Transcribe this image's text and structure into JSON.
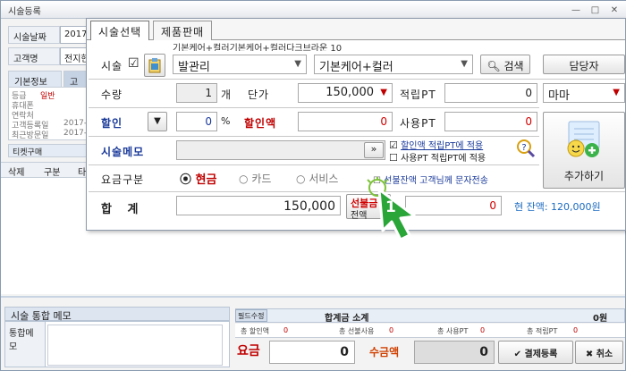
{
  "window": {
    "title": "시술등록",
    "min": "—",
    "max": "□",
    "close": "✕"
  },
  "left_panel": {
    "date_label": "시술날짜",
    "date_value": "2017-",
    "customer_label": "고객명",
    "customer_value": "전지현",
    "tabs": [
      "기본정보",
      "고"
    ],
    "info_rows": [
      {
        "label": "등급",
        "value": "일반"
      },
      {
        "label": "휴대폰",
        "value": ""
      },
      {
        "label": "연락처",
        "value": ""
      },
      {
        "label": "고객등록일",
        "value": "2017-0"
      },
      {
        "label": "최근방문일",
        "value": "2017-0"
      }
    ],
    "ticket_label": "티켓구매",
    "list_headers": [
      "삭제",
      "구분",
      "타"
    ]
  },
  "dialog": {
    "tabs": [
      "시술선택",
      "제품판매"
    ],
    "crumbs": [
      "기본케어+컬러",
      "기본케어+컬러",
      "다크브라운 10"
    ],
    "service_label": "시술",
    "service_check": "☑",
    "category_value": "발관리",
    "item_value": "기본케어+컬러",
    "search_label": "검색",
    "staff_button": "담당자",
    "staff_value": "마마",
    "qty_label": "수량",
    "qty_value": "1",
    "qty_unit": "개",
    "price_label": "단가",
    "price_value": "150,000",
    "earn_pt_label": "적립PT",
    "earn_pt_value": "0",
    "discount_label": "할인",
    "discount_value": "0",
    "discount_unit": "%",
    "discount_amt_label": "할인액",
    "discount_amt_value": "0",
    "use_pt_label": "사용PT",
    "use_pt_value": "0",
    "memo_label": "시술메모",
    "memo_btn": "»",
    "chk1_label": "할인액 적립PT에 적용",
    "chk2_label": "사용PT 적립PT에 적용",
    "add_button": "추가하기",
    "pay_label": "요금구분",
    "pay_options": [
      "현금",
      "카드",
      "서비스"
    ],
    "prepaid_sms_label": "선불잔액 고객님께 문자전송",
    "total_label": "합   계",
    "total_value": "150,000",
    "prepaid_btn_top": "선불금",
    "prepaid_btn_bottom": "전액",
    "prepaid_value": "0",
    "balance_text": "현 잔액: 120,000원",
    "cursor_number": "1"
  },
  "bottom": {
    "memo_title": "시술 통합 메모",
    "memo_label": "통합메모",
    "edit_label": "필드수정",
    "sum_title": "합계금 소계",
    "sum_value": "0원",
    "stats": [
      {
        "label": "총 할인액",
        "value": "0"
      },
      {
        "label": "총 선불사용",
        "value": "0"
      },
      {
        "label": "총 사용PT",
        "value": "0"
      },
      {
        "label": "총 적립PT",
        "value": "0"
      }
    ],
    "fee_label": "요금",
    "fee_value": "0",
    "collect_label": "수금액",
    "collect_value": "0",
    "register_btn": "결제등록",
    "cancel_btn": "취소"
  }
}
